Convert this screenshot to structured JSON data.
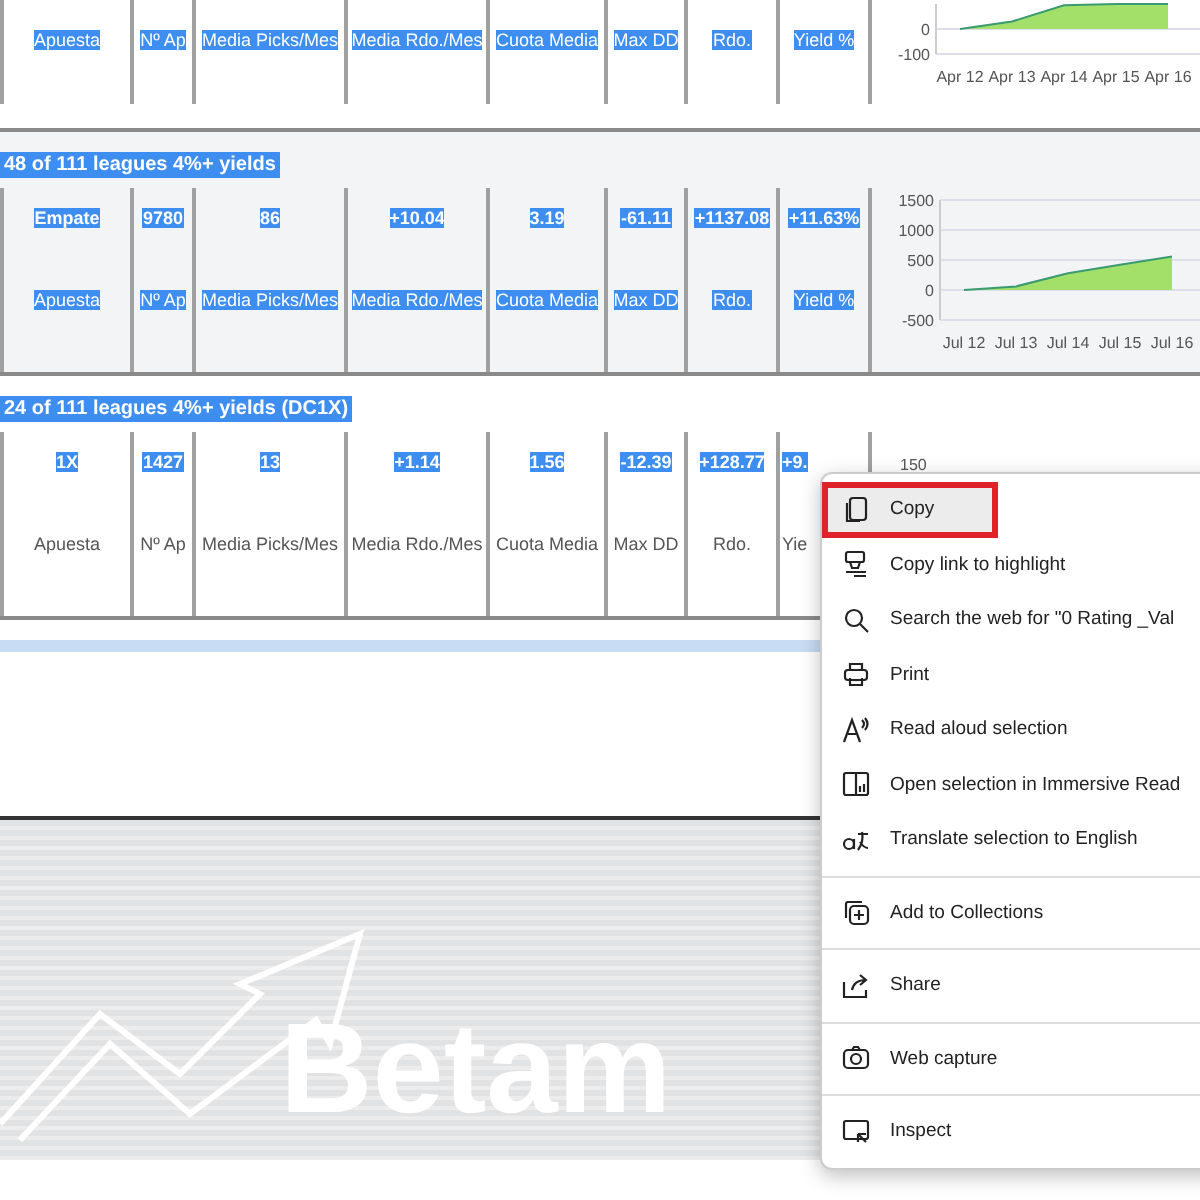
{
  "sections": [
    {
      "labels": [
        "Apuesta",
        "Nº Ap",
        "Media Picks/Mes",
        "Media Rdo./Mes",
        "Cuota Media",
        "Max DD",
        "Rdo.",
        "Yield %"
      ],
      "labels_highlighted": true,
      "shaded": false,
      "chart_data": {
        "type": "area",
        "categories": [
          "Apr 12",
          "Apr 13",
          "Apr 14",
          "Apr 15",
          "Apr 16"
        ],
        "yticks": [
          -100,
          0
        ],
        "ylim": [
          -100,
          100
        ],
        "grid": true,
        "series": [
          {
            "color": "#a3e06a",
            "values": [
              0,
              30,
              95,
              100,
              100
            ]
          }
        ]
      }
    },
    {
      "title": "48 of 111 leagues 4%+ yields",
      "title_highlighted": true,
      "values": [
        "Empate",
        "9780",
        "86",
        "+10.04",
        "3.19",
        "-61.11",
        "+1137.08",
        "+11.63%"
      ],
      "values_highlighted": true,
      "labels": [
        "Apuesta",
        "Nº Ap",
        "Media Picks/Mes",
        "Media Rdo./Mes",
        "Cuota Media",
        "Max DD",
        "Rdo.",
        "Yield %"
      ],
      "labels_highlighted": true,
      "shaded": true,
      "chart_data": {
        "type": "area",
        "categories": [
          "Jul 12",
          "Jul 13",
          "Jul 14",
          "Jul 15",
          "Jul 16"
        ],
        "yticks": [
          -500,
          0,
          500,
          1000,
          1500
        ],
        "ylim": [
          -500,
          1500
        ],
        "grid": true,
        "series": [
          {
            "color": "#a3e06a",
            "values": [
              0,
              60,
              280,
              420,
              560
            ]
          }
        ]
      }
    },
    {
      "title": "24 of 111 leagues 4%+ yields (DC1X)",
      "title_highlighted": true,
      "values": [
        "1X",
        "1427",
        "13",
        "+1.14",
        "1.56",
        "-12.39",
        "+128.77",
        "+9."
      ],
      "values_highlighted": true,
      "labels": [
        "Apuesta",
        "Nº Ap",
        "Media Picks/Mes",
        "Media Rdo./Mes",
        "Cuota Media",
        "Max DD",
        "Rdo.",
        "Yie"
      ],
      "labels_highlighted": false,
      "shaded": false,
      "chart_tick": "150"
    }
  ],
  "footer": {
    "brand": "Betam"
  },
  "context_menu": {
    "groups": [
      [
        {
          "label": "Copy",
          "selected": true,
          "annotated": true
        },
        {
          "label": "Copy link to highlight",
          "selected": false,
          "annotated": false
        },
        {
          "label": "Search the web for \"0 Rating _Val",
          "selected": false,
          "annotated": false
        },
        {
          "label": "Print",
          "selected": false,
          "annotated": false
        },
        {
          "label": "Read aloud selection",
          "selected": false,
          "annotated": false
        },
        {
          "label": "Open selection in Immersive Read",
          "selected": false,
          "annotated": false
        },
        {
          "label": "Translate selection to English",
          "selected": false,
          "annotated": false
        }
      ],
      [
        {
          "label": "Add to Collections",
          "selected": false,
          "annotated": false
        }
      ],
      [
        {
          "label": "Share",
          "selected": false,
          "annotated": false
        }
      ],
      [
        {
          "label": "Web capture",
          "selected": false,
          "annotated": false
        }
      ],
      [
        {
          "label": "Inspect",
          "selected": false,
          "annotated": false
        }
      ]
    ]
  }
}
